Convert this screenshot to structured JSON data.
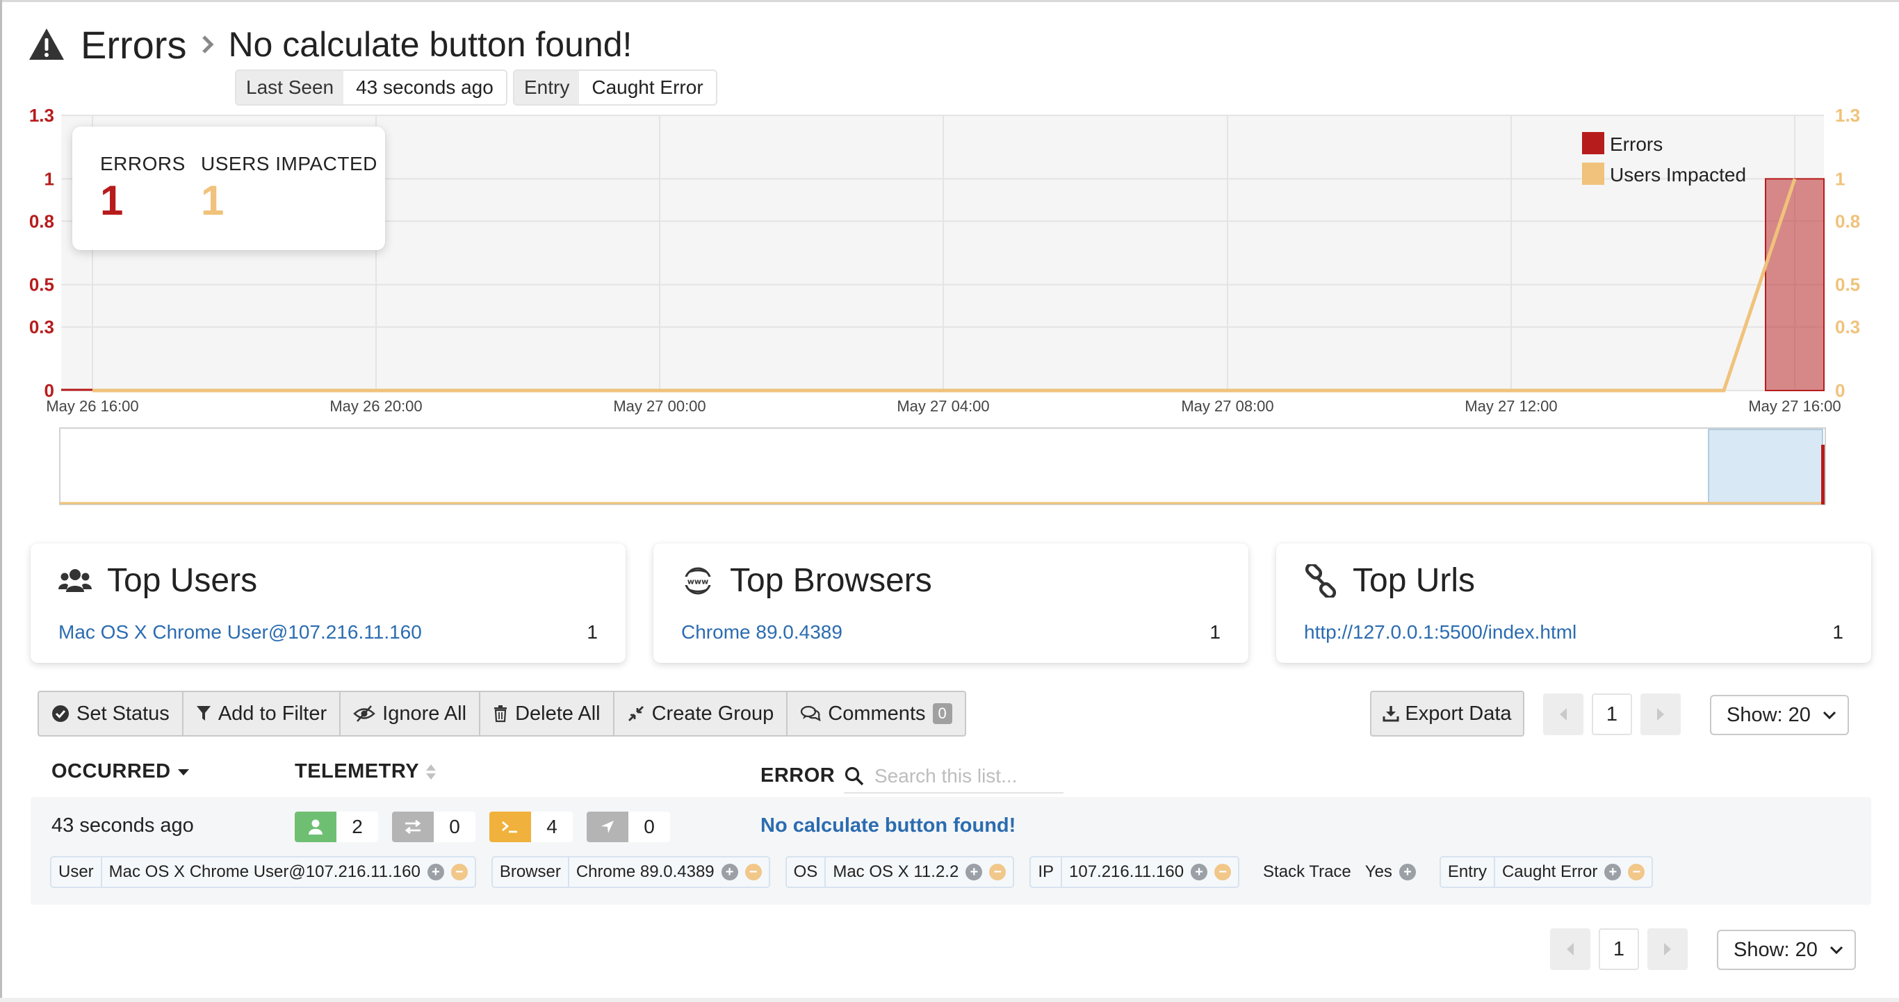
{
  "header": {
    "section": "Errors",
    "title": "No calculate button found!",
    "last_seen_label": "Last Seen",
    "last_seen_value": "43 seconds ago",
    "entry_label": "Entry",
    "entry_value": "Caught Error"
  },
  "summary": {
    "errors_label": "ERRORS",
    "errors_value": "1",
    "users_label": "USERS IMPACTED",
    "users_value": "1"
  },
  "colors": {
    "errors": "#b71c1c",
    "users": "#f0c27b",
    "link": "#2b6cb0"
  },
  "chart_data": {
    "type": "bar",
    "x": [
      "May 26 16:00",
      "May 26 20:00",
      "May 27 00:00",
      "May 27 04:00",
      "May 27 08:00",
      "May 27 12:00",
      "May 27 16:00"
    ],
    "y_left_ticks": [
      "1.3",
      "1",
      "0.8",
      "0.5",
      "0.3",
      "0"
    ],
    "y_right_ticks": [
      "1.3",
      "1",
      "0.8",
      "0.5",
      "0.3",
      "0"
    ],
    "ylim": [
      0,
      1.3
    ],
    "legend": [
      "Errors",
      "Users Impacted"
    ],
    "legend_position": "top-right",
    "grid": true,
    "series": [
      {
        "name": "Errors",
        "type": "bar",
        "points": [
          {
            "x": "May 27 16:00",
            "y": 1
          }
        ]
      },
      {
        "name": "Users Impacted",
        "type": "line",
        "points": [
          {
            "x": "May 26 16:00",
            "y": 0
          },
          {
            "x": "May 27 15:00",
            "y": 0
          },
          {
            "x": "May 27 16:00",
            "y": 1
          }
        ]
      }
    ]
  },
  "panels": {
    "users": {
      "title": "Top Users",
      "item": "Mac OS X Chrome User@107.216.11.160",
      "count": "1"
    },
    "browsers": {
      "title": "Top Browsers",
      "item": "Chrome 89.0.4389",
      "count": "1"
    },
    "urls": {
      "title": "Top Urls",
      "item": "http://127.0.0.1:5500/index.html",
      "count": "1"
    }
  },
  "toolbar": {
    "set_status": "Set Status",
    "add_filter": "Add to Filter",
    "ignore_all": "Ignore All",
    "delete_all": "Delete All",
    "create_group": "Create Group",
    "comments": "Comments",
    "comments_count": "0",
    "export": "Export Data"
  },
  "pagination": {
    "page": "1",
    "show": "Show: 20"
  },
  "table": {
    "col_occurred": "OCCURRED",
    "col_telemetry": "TELEMETRY",
    "col_error": "ERROR",
    "search_placeholder": "Search this list...",
    "row": {
      "occurred": "43 seconds ago",
      "telemetry": {
        "users": "2",
        "network": "0",
        "console": "4",
        "navigation": "0"
      },
      "error": "No calculate button found!",
      "tags": [
        {
          "key": "User",
          "value": "Mac OS X Chrome User@107.216.11.160"
        },
        {
          "key": "Browser",
          "value": "Chrome 89.0.4389"
        },
        {
          "key": "OS",
          "value": "Mac OS X 11.2.2"
        },
        {
          "key": "IP",
          "value": "107.216.11.160"
        },
        {
          "key": "Stack Trace",
          "value": "Yes"
        },
        {
          "key": "Entry",
          "value": "Caught Error"
        }
      ]
    }
  }
}
